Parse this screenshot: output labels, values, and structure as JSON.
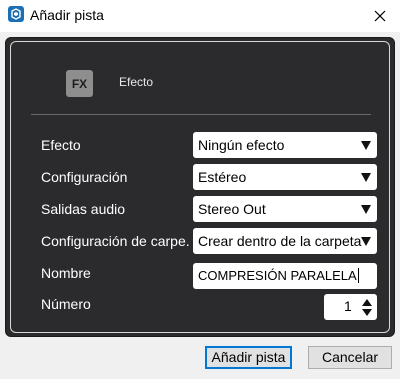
{
  "window": {
    "title": "Añadir pista",
    "close_icon": "close-icon"
  },
  "panel": {
    "fx_badge": "FX",
    "section_title": "Efecto"
  },
  "form": {
    "rows": [
      {
        "label": "Efecto",
        "value": "Ningún efecto"
      },
      {
        "label": "Configuración",
        "value": "Estéreo"
      },
      {
        "label": "Salidas audio",
        "value": "Stereo Out"
      },
      {
        "label": "Configuración de carpe.",
        "value": "Crear dentro de la carpeta"
      }
    ],
    "name_label": "Nombre",
    "name_value": "COMPRESIÓN PARALELA",
    "number_label": "Número",
    "number_value": "1"
  },
  "buttons": {
    "add": "Añadir pista",
    "cancel": "Cancelar"
  },
  "colors": {
    "panel_bg": "#2b2b2d",
    "accent": "#0078d7",
    "app_icon": "#1b6fb5"
  }
}
